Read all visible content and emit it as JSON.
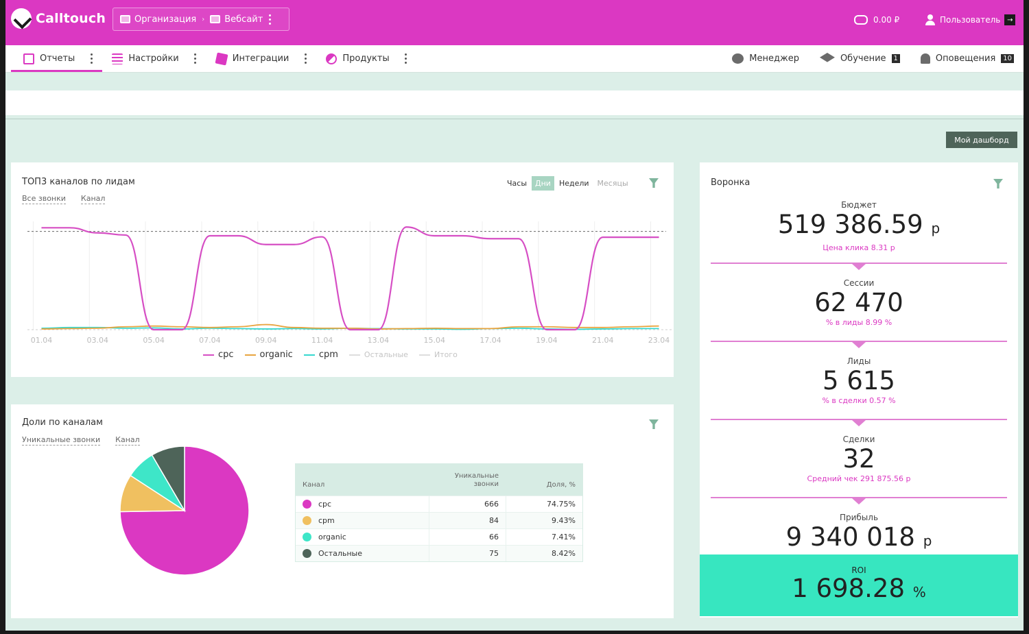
{
  "header": {
    "brand": "Calltouch",
    "breadcrumb": [
      "Организация",
      "Вебсайт"
    ],
    "balance": "0.00 ₽",
    "user": "Пользователь"
  },
  "nav": {
    "items": [
      {
        "label": "Отчеты",
        "icon": "report-icon"
      },
      {
        "label": "Настройки",
        "icon": "settings-icon"
      },
      {
        "label": "Интеграции",
        "icon": "integrations-icon"
      },
      {
        "label": "Продукты",
        "icon": "products-icon"
      }
    ],
    "right": [
      {
        "label": "Менеджер",
        "icon": "manager-icon",
        "badge": ""
      },
      {
        "label": "Обучение",
        "icon": "graduation-cap-icon",
        "badge": "1"
      },
      {
        "label": "Оповещения",
        "icon": "bell-icon",
        "badge": "10"
      }
    ]
  },
  "dashboard_button": "Мой дашборд",
  "top_channels": {
    "title": "ТОП3 каналов по лидам",
    "filters": [
      "Все звонки",
      "Канал"
    ],
    "periods": [
      "Часы",
      "Дни",
      "Недели",
      "Месяцы"
    ],
    "selected_period": "Дни",
    "legend": [
      "cpc",
      "organic",
      "cpm",
      "Остальные",
      "Итого"
    ]
  },
  "shares": {
    "title": "Доли по каналам",
    "filters": [
      "Уникальные звонки",
      "Канал"
    ],
    "columns": [
      "Канал",
      "Уникальные звонки",
      "Доля, %"
    ],
    "rows": [
      {
        "channel": "cpc",
        "calls": "666",
        "share": "74.75%",
        "color": "#db38c2"
      },
      {
        "channel": "cpm",
        "calls": "84",
        "share": "9.43%",
        "color": "#f0c060"
      },
      {
        "channel": "organic",
        "calls": "66",
        "share": "7.41%",
        "color": "#3ee6c8"
      },
      {
        "channel": "Остальные",
        "calls": "75",
        "share": "8.42%",
        "color": "#4e6459"
      }
    ]
  },
  "funnel": {
    "title": "Воронка",
    "budget": {
      "label": "Бюджет",
      "value": "519 386.59",
      "unit": "р",
      "note": "Цена клика 8.31 р"
    },
    "sessions": {
      "label": "Сессии",
      "value": "62 470",
      "note": "% в лиды 8.99 %"
    },
    "leads": {
      "label": "Лиды",
      "value": "5 615",
      "note": "% в сделки 0.57 %"
    },
    "deals": {
      "label": "Сделки",
      "value": "32",
      "note": "Средний чек 291 875.56 р"
    },
    "profit": {
      "label": "Прибыль",
      "value": "9 340 018",
      "unit": "р"
    },
    "roi": {
      "label": "ROI",
      "value": "1 698.28",
      "unit": "%"
    }
  },
  "chart_data": [
    {
      "type": "line",
      "title": "ТОП3 каналов по лидам",
      "x": [
        "01.04",
        "02.04",
        "03.04",
        "04.04",
        "05.04",
        "06.04",
        "07.04",
        "08.04",
        "09.04",
        "10.04",
        "11.04",
        "12.04",
        "13.04",
        "14.04",
        "15.04",
        "16.04",
        "17.04",
        "18.04",
        "19.04",
        "20.04",
        "21.04",
        "22.04",
        "23.04"
      ],
      "x_tick_labels": [
        "01.04",
        "03.04",
        "05.04",
        "07.04",
        "09.04",
        "11.04",
        "13.04",
        "15.04",
        "17.04",
        "19.04",
        "21.04",
        "23.04"
      ],
      "series": [
        {
          "name": "cpc",
          "color": "#d64ec4",
          "values": [
            280,
            280,
            266,
            260,
            0,
            0,
            258,
            258,
            234,
            234,
            255,
            0,
            0,
            282,
            258,
            258,
            250,
            250,
            0,
            0,
            254,
            254,
            254
          ]
        },
        {
          "name": "organic",
          "color": "#e8a440",
          "values": [
            2,
            3,
            4,
            8,
            10,
            8,
            6,
            8,
            14,
            6,
            4,
            4,
            2,
            3,
            4,
            3,
            3,
            8,
            8,
            6,
            6,
            8,
            10
          ]
        },
        {
          "name": "cpm",
          "color": "#35d8cf",
          "values": [
            4,
            6,
            6,
            4,
            5,
            2,
            4,
            3,
            2,
            3,
            2,
            4,
            3,
            2,
            2,
            1,
            3,
            4,
            2,
            1,
            2,
            3,
            3
          ]
        }
      ],
      "reference_line": 270,
      "legend": [
        "cpc",
        "organic",
        "cpm",
        "Остальные",
        "Итого"
      ]
    },
    {
      "type": "pie",
      "title": "Доли по каналам",
      "categories": [
        "cpc",
        "cpm",
        "organic",
        "Остальные"
      ],
      "values": [
        74.75,
        9.43,
        7.41,
        8.42
      ],
      "colors": [
        "#db38c2",
        "#f0c060",
        "#3ee6c8",
        "#4e6459"
      ]
    }
  ]
}
